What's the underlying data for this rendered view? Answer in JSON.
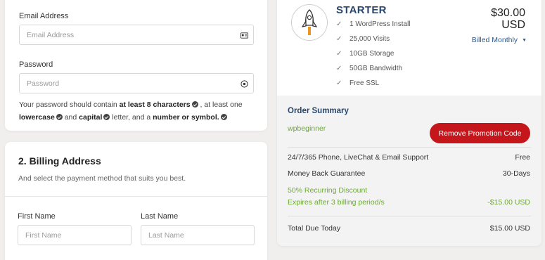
{
  "account": {
    "email_label": "Email Address",
    "email_placeholder": "Email Address",
    "password_label": "Password",
    "password_placeholder": "Password",
    "hint": {
      "p1": "Your password should contain ",
      "b1": "at least 8 characters",
      "p2": " , at least one ",
      "b2": "lowercase",
      "p3": " and ",
      "b3": "capital",
      "p4": " letter, and a ",
      "b4": "number or symbol."
    }
  },
  "billing": {
    "title": "2. Billing Address",
    "subtitle": "And select the payment method that suits you best.",
    "first_name_label": "First Name",
    "first_name_placeholder": "First Name",
    "last_name_label": "Last Name",
    "last_name_placeholder": "Last Name"
  },
  "plan": {
    "name": "STARTER",
    "price_amount": "$30.00",
    "price_currency": "USD",
    "billing_cycle": "Billed Monthly",
    "features": [
      "1 WordPress Install",
      "25,000 Visits",
      "10GB Storage",
      "50GB Bandwidth",
      "Free SSL"
    ]
  },
  "order": {
    "title": "Order Summary",
    "promo_code": "wpbeginner",
    "remove_label": "Remove Promotion Code",
    "rows": [
      {
        "label": "24/7/365 Phone, LiveChat & Email Support",
        "value": "Free"
      },
      {
        "label": "Money Back Guarantee",
        "value": "30-Days"
      },
      {
        "label": "50% Recurring Discount",
        "value": ""
      },
      {
        "label": "Expires after 3 billing period/s",
        "value": "-$15.00 USD"
      }
    ],
    "total_label": "Total Due Today",
    "total_value": "$15.00 USD"
  },
  "colors": {
    "brand_navy": "#28476e",
    "link_blue": "#2c5a8f",
    "discount_green": "#6aaa2e",
    "remove_red": "#c5161b"
  },
  "icons": [
    "card-icon",
    "eye-icon",
    "check-circle-icon",
    "rocket-icon",
    "check-icon",
    "caret-down-icon"
  ]
}
